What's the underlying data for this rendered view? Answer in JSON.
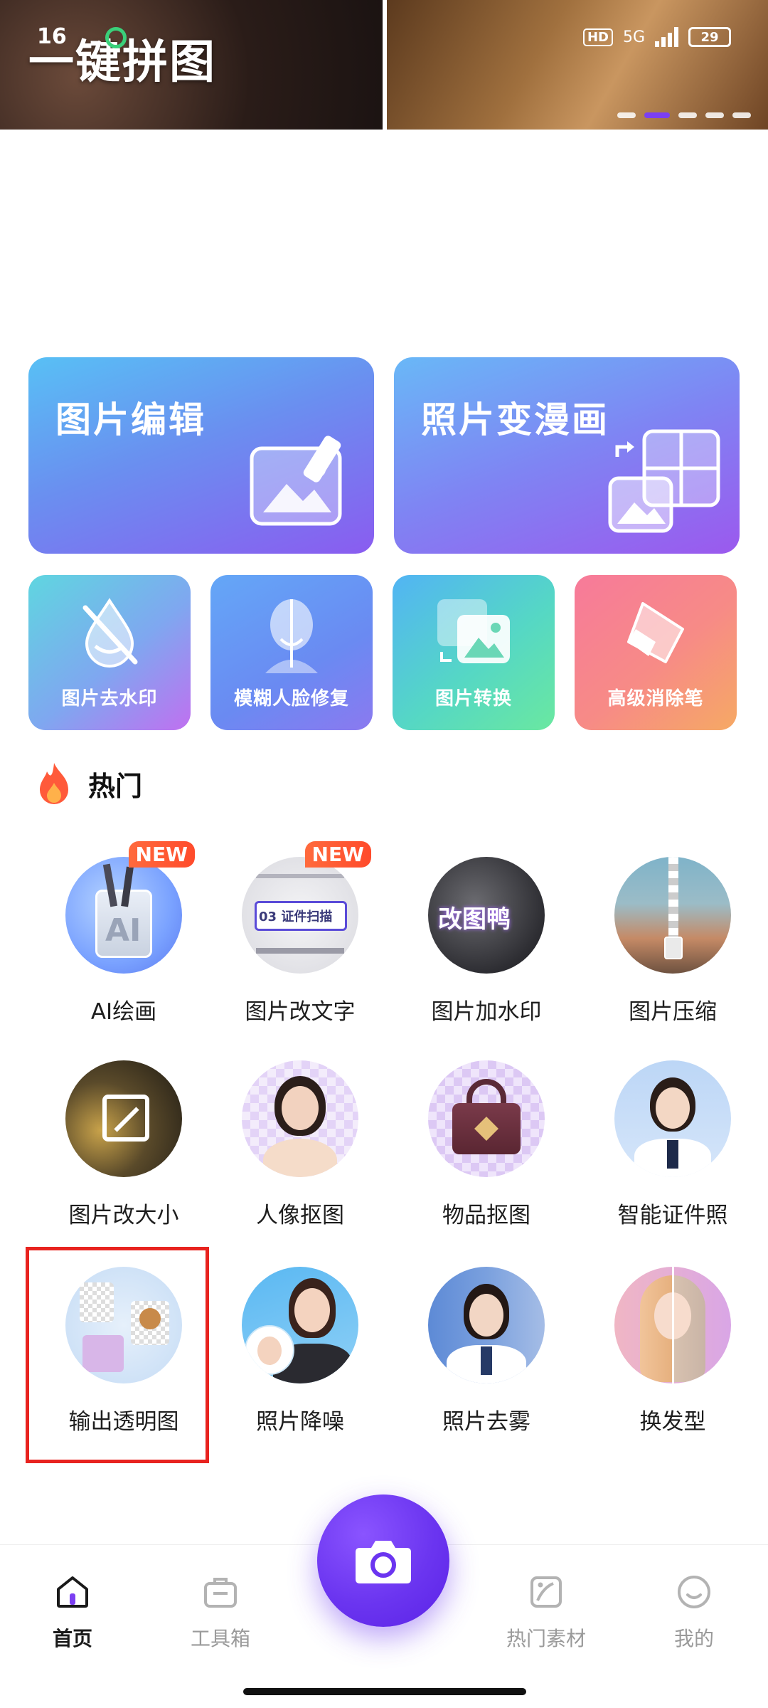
{
  "status_bar": {
    "time": "16",
    "network_badge": "HD",
    "network_type": "5G",
    "battery": "29"
  },
  "banner": {
    "title": "一键拼图",
    "dots": 5,
    "active_dot": 2
  },
  "big_cards": [
    {
      "label": "图片编辑",
      "icon": "photo-edit-icon"
    },
    {
      "label": "照片变漫画",
      "icon": "photo-to-comic-icon"
    }
  ],
  "small_cards": [
    {
      "label": "图片去水印",
      "icon": "remove-watermark-icon"
    },
    {
      "label": "模糊人脸修复",
      "icon": "face-restore-icon"
    },
    {
      "label": "图片转换",
      "icon": "image-convert-icon"
    },
    {
      "label": "高级消除笔",
      "icon": "eraser-icon"
    }
  ],
  "hot": {
    "heading": "热门",
    "items": [
      {
        "label": "AI绘画",
        "badge": "NEW",
        "thumb_text": "AI"
      },
      {
        "label": "图片改文字",
        "badge": "NEW",
        "thumb_text": "03 证件扫描"
      },
      {
        "label": "图片加水印",
        "thumb_text": "改图鸭"
      },
      {
        "label": "图片压缩"
      },
      {
        "label": "图片改大小"
      },
      {
        "label": "人像抠图"
      },
      {
        "label": "物品抠图"
      },
      {
        "label": "智能证件照"
      },
      {
        "label": "输出透明图"
      },
      {
        "label": "照片降噪"
      },
      {
        "label": "照片去雾"
      },
      {
        "label": "换发型"
      }
    ]
  },
  "bottom_nav": [
    {
      "label": "首页",
      "icon": "home-icon",
      "active": true
    },
    {
      "label": "工具箱",
      "icon": "toolbox-icon",
      "active": false
    },
    {
      "label": "热门素材",
      "icon": "hot-material-icon",
      "active": false
    },
    {
      "label": "我的",
      "icon": "profile-icon",
      "active": false
    }
  ],
  "colors": {
    "accent": "#6b35f0",
    "highlight_box": "#e8231f",
    "new_badge": "#ff5a34"
  }
}
